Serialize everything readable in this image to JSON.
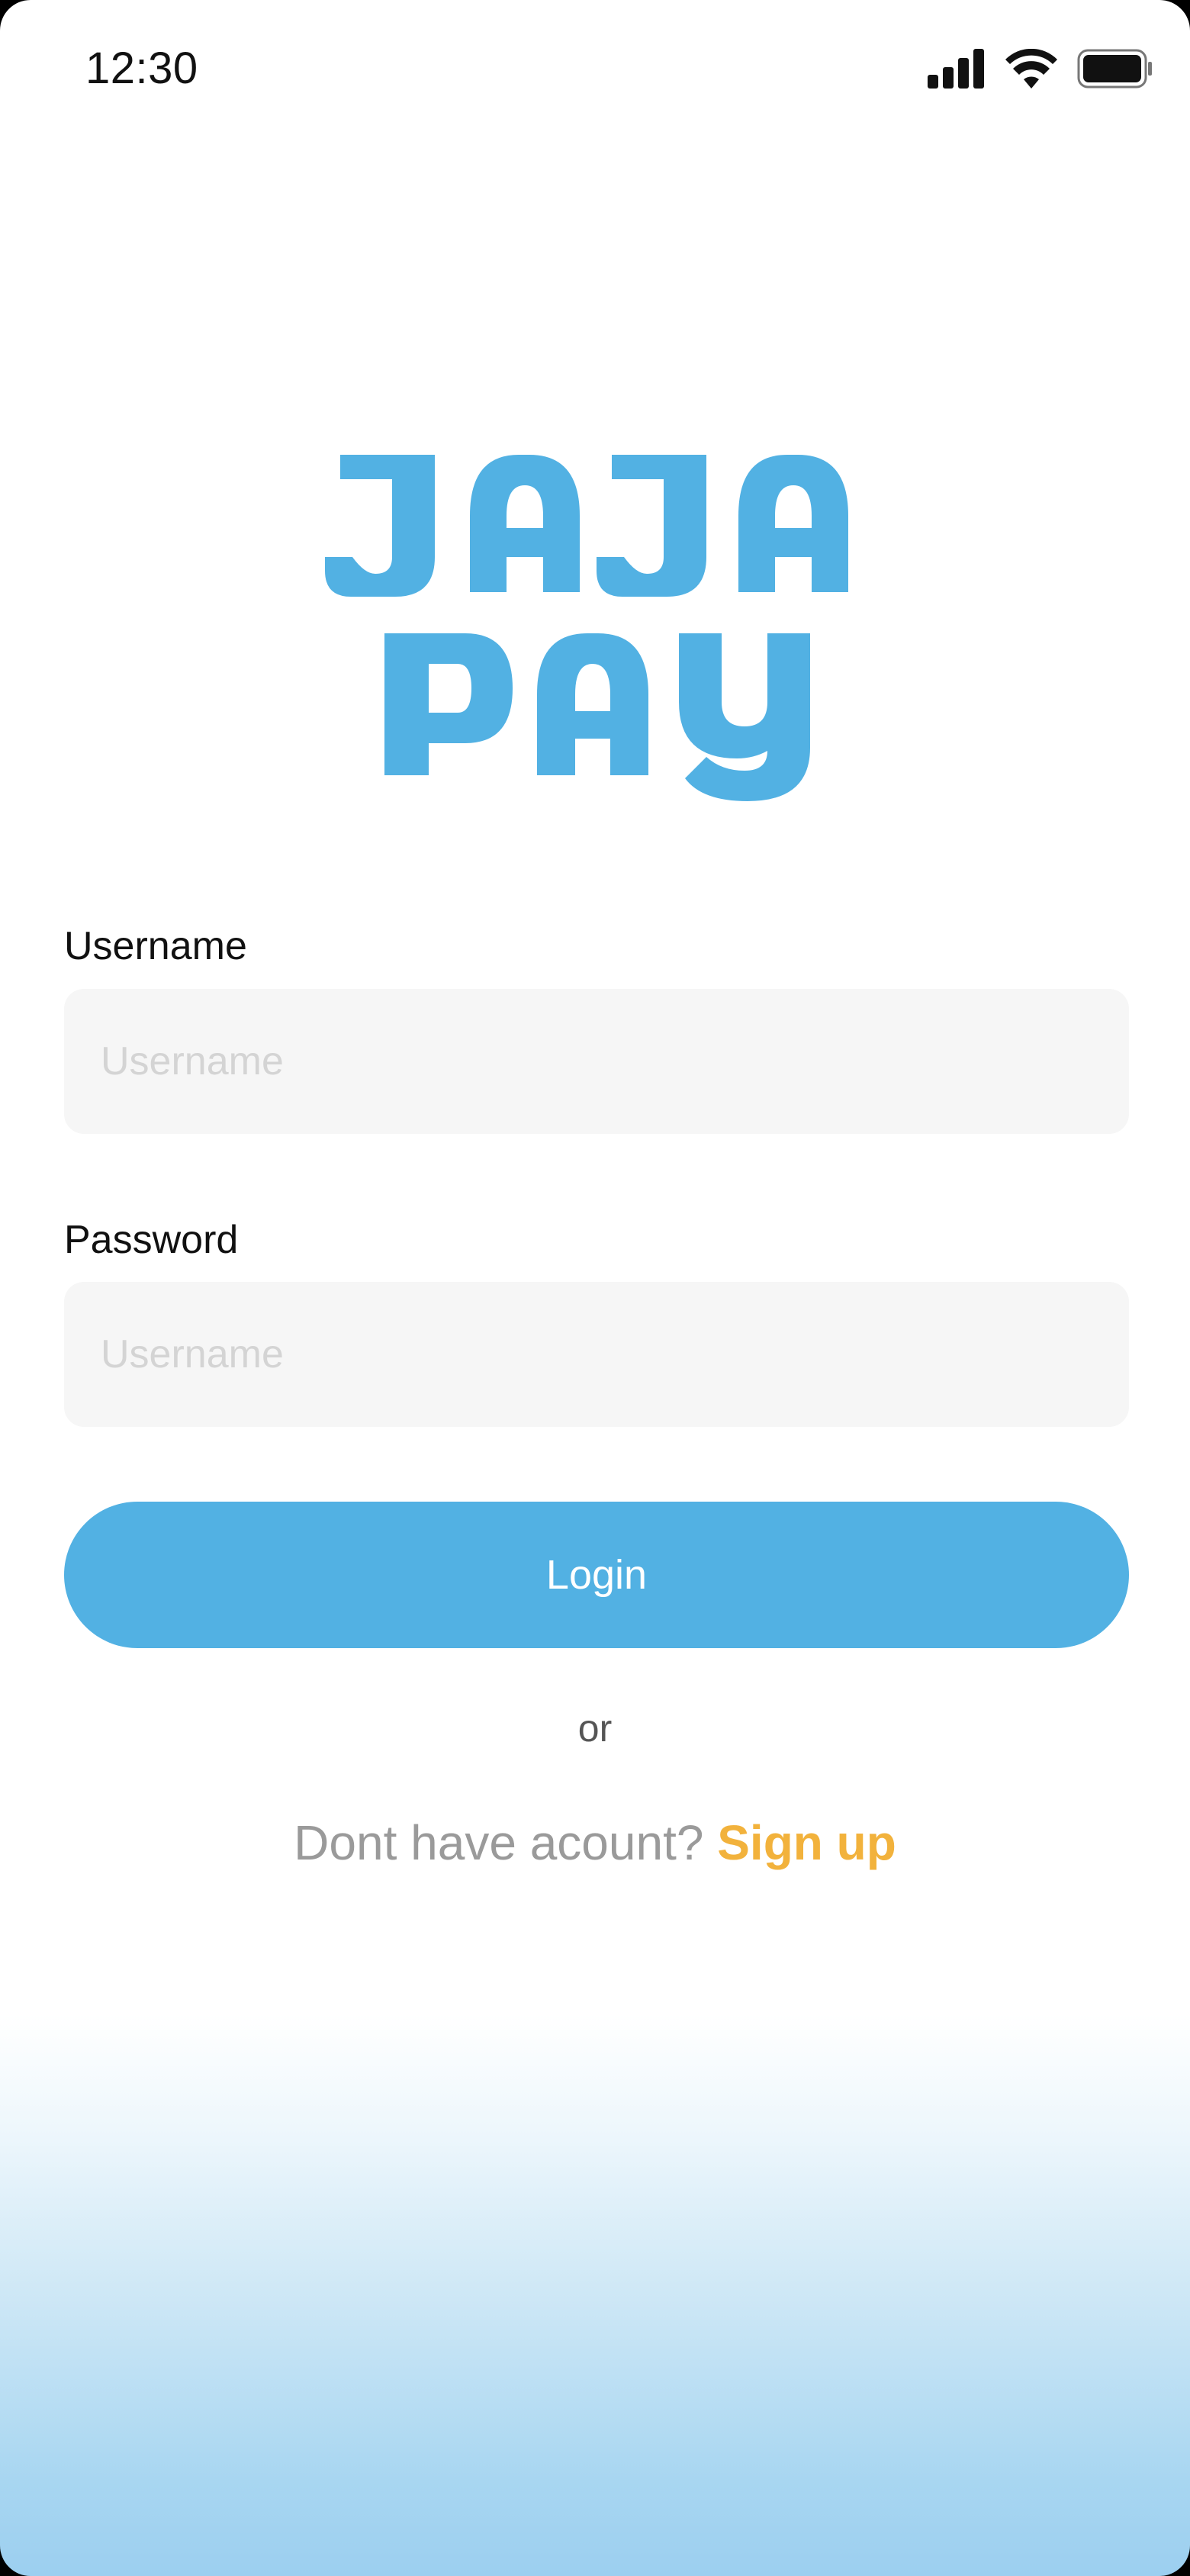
{
  "status_bar": {
    "time": "12:30"
  },
  "brand": {
    "logo_line_1": "JAJA",
    "logo_line_2": "PAY",
    "color": "#52b1e3"
  },
  "form": {
    "username": {
      "label": "Username",
      "placeholder": "Username",
      "value": ""
    },
    "password": {
      "label": "Password",
      "placeholder": "Username",
      "value": ""
    },
    "login_label": "Login"
  },
  "divider_text": "or",
  "signup": {
    "prompt": "Dont have acount?",
    "link_label": "Sign up",
    "link_color": "#f2b23c"
  },
  "icons": [
    "signal-icon",
    "wifi-icon",
    "battery-icon"
  ],
  "colors": {
    "accent": "#52b1e3",
    "input_background": "#f6f6f6",
    "link": "#f2b23c"
  }
}
